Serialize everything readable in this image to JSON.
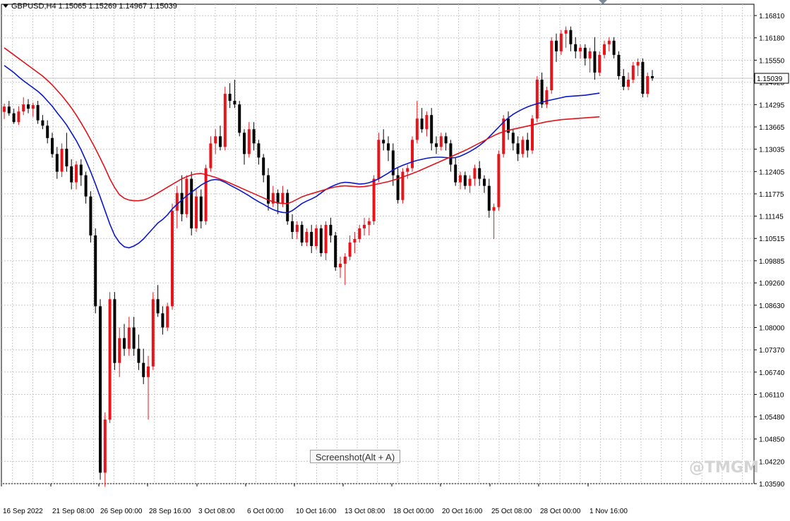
{
  "header": {
    "symbol": "GBPUSD,H4",
    "open": "1.15065",
    "high": "1.15269",
    "low": "1.14967",
    "close": "1.15039"
  },
  "screenshot_button": "Screenshot(Alt + A)",
  "watermark": "@TMGM",
  "colors": {
    "bull": "#e8141c",
    "bear": "#000000",
    "ma_fast": "#0a18c8",
    "ma_slow": "#e0141c",
    "grid": "#c8c8c8",
    "price_line": "#c0c0c0"
  },
  "chart_data": {
    "type": "candlestick",
    "title": "GBPUSD,H4",
    "ylim": [
      1.0359,
      1.1713
    ],
    "y_ticks": [
      "1.16810",
      "1.16180",
      "1.15550",
      "1.14925",
      "1.14295",
      "1.13665",
      "1.13035",
      "1.12405",
      "1.11775",
      "1.11145",
      "1.10515",
      "1.09885",
      "1.09260",
      "1.08630",
      "1.08000",
      "1.07370",
      "1.06740",
      "1.06110",
      "1.05480",
      "1.04850",
      "1.04220",
      "1.03590"
    ],
    "x_ticks": [
      "16 Sep 2022",
      "21 Sep 08:00",
      "26 Sep 00:00",
      "28 Sep 16:00",
      "3 Oct 08:00",
      "6 Oct 00:00",
      "10 Oct 16:00",
      "13 Oct 08:00",
      "18 Oct 00:00",
      "20 Oct 16:00",
      "25 Oct 08:00",
      "28 Oct 00:00",
      "1 Nov 16:00"
    ],
    "current_price": "1.15039",
    "grid": true,
    "candles": [
      [
        1.1409,
        1.1432,
        1.1389,
        1.1424
      ],
      [
        1.1424,
        1.144,
        1.1398,
        1.1405
      ],
      [
        1.1405,
        1.1418,
        1.1375,
        1.138
      ],
      [
        1.138,
        1.1425,
        1.1372,
        1.141
      ],
      [
        1.141,
        1.145,
        1.14,
        1.143
      ],
      [
        1.143,
        1.1445,
        1.1405,
        1.1418
      ],
      [
        1.1418,
        1.1435,
        1.1395,
        1.1428
      ],
      [
        1.1428,
        1.144,
        1.1375,
        1.1385
      ],
      [
        1.1385,
        1.14,
        1.136,
        1.137
      ],
      [
        1.137,
        1.1385,
        1.132,
        1.1335
      ],
      [
        1.1335,
        1.135,
        1.128,
        1.129
      ],
      [
        1.129,
        1.131,
        1.122,
        1.124
      ],
      [
        1.124,
        1.132,
        1.1225,
        1.1305
      ],
      [
        1.1305,
        1.135,
        1.124,
        1.1255
      ],
      [
        1.1255,
        1.1275,
        1.119,
        1.121
      ],
      [
        1.121,
        1.127,
        1.119,
        1.126
      ],
      [
        1.126,
        1.1275,
        1.12,
        1.123
      ],
      [
        1.123,
        1.124,
        1.115,
        1.117
      ],
      [
        1.117,
        1.1185,
        1.104,
        1.106
      ],
      [
        1.106,
        1.108,
        1.084,
        1.086
      ],
      [
        1.086,
        1.088,
        1.037,
        1.039
      ],
      [
        1.039,
        1.056,
        1.035,
        1.054
      ],
      [
        1.054,
        1.09,
        1.053,
        1.088
      ],
      [
        1.088,
        1.09,
        1.068,
        1.07
      ],
      [
        1.07,
        1.08,
        1.066,
        1.077
      ],
      [
        1.077,
        1.081,
        1.072,
        1.074
      ],
      [
        1.074,
        1.083,
        1.072,
        1.08
      ],
      [
        1.08,
        1.083,
        1.072,
        1.074
      ],
      [
        1.074,
        1.078,
        1.068,
        1.07
      ],
      [
        1.07,
        1.074,
        1.064,
        1.066
      ],
      [
        1.066,
        1.072,
        1.054,
        1.069
      ],
      [
        1.069,
        1.09,
        1.068,
        1.088
      ],
      [
        1.088,
        1.092,
        1.083,
        1.084
      ],
      [
        1.084,
        1.086,
        1.078,
        1.08
      ],
      [
        1.08,
        1.087,
        1.079,
        1.086
      ],
      [
        1.086,
        1.115,
        1.085,
        1.113
      ],
      [
        1.113,
        1.12,
        1.108,
        1.118
      ],
      [
        1.118,
        1.123,
        1.11,
        1.112
      ],
      [
        1.112,
        1.123,
        1.111,
        1.122
      ],
      [
        1.122,
        1.124,
        1.106,
        1.108
      ],
      [
        1.108,
        1.119,
        1.107,
        1.117
      ],
      [
        1.117,
        1.119,
        1.108,
        1.11
      ],
      [
        1.11,
        1.126,
        1.109,
        1.125
      ],
      [
        1.125,
        1.134,
        1.124,
        1.132
      ],
      [
        1.132,
        1.136,
        1.129,
        1.134
      ],
      [
        1.134,
        1.137,
        1.13,
        1.131
      ],
      [
        1.131,
        1.148,
        1.13,
        1.146
      ],
      [
        1.146,
        1.149,
        1.142,
        1.144
      ],
      [
        1.144,
        1.15,
        1.142,
        1.143
      ],
      [
        1.143,
        1.144,
        1.134,
        1.135
      ],
      [
        1.135,
        1.136,
        1.126,
        1.129
      ],
      [
        1.129,
        1.138,
        1.128,
        1.136
      ],
      [
        1.136,
        1.138,
        1.13,
        1.132
      ],
      [
        1.132,
        1.133,
        1.126,
        1.128
      ],
      [
        1.128,
        1.129,
        1.121,
        1.123
      ],
      [
        1.123,
        1.125,
        1.113,
        1.115
      ],
      [
        1.115,
        1.12,
        1.114,
        1.118
      ],
      [
        1.118,
        1.119,
        1.112,
        1.115
      ],
      [
        1.115,
        1.12,
        1.114,
        1.118
      ],
      [
        1.118,
        1.119,
        1.109,
        1.11
      ],
      [
        1.11,
        1.112,
        1.105,
        1.107
      ],
      [
        1.107,
        1.11,
        1.105,
        1.109
      ],
      [
        1.109,
        1.11,
        1.103,
        1.104
      ],
      [
        1.104,
        1.108,
        1.103,
        1.107
      ],
      [
        1.107,
        1.109,
        1.101,
        1.103
      ],
      [
        1.103,
        1.109,
        1.102,
        1.108
      ],
      [
        1.108,
        1.109,
        1.1,
        1.101
      ],
      [
        1.101,
        1.11,
        1.099,
        1.109
      ],
      [
        1.109,
        1.111,
        1.104,
        1.106
      ],
      [
        1.106,
        1.107,
        1.096,
        1.097
      ],
      [
        1.097,
        1.1,
        1.094,
        1.098
      ],
      [
        1.098,
        1.101,
        1.092,
        1.1
      ],
      [
        1.1,
        1.106,
        1.099,
        1.104
      ],
      [
        1.104,
        1.107,
        1.101,
        1.105
      ],
      [
        1.105,
        1.109,
        1.104,
        1.108
      ],
      [
        1.108,
        1.111,
        1.106,
        1.109
      ],
      [
        1.109,
        1.111,
        1.106,
        1.11
      ],
      [
        1.11,
        1.123,
        1.109,
        1.122
      ],
      [
        1.122,
        1.135,
        1.121,
        1.133
      ],
      [
        1.133,
        1.136,
        1.13,
        1.132
      ],
      [
        1.132,
        1.134,
        1.127,
        1.13
      ],
      [
        1.13,
        1.132,
        1.12,
        1.123
      ],
      [
        1.123,
        1.125,
        1.115,
        1.116
      ],
      [
        1.116,
        1.125,
        1.115,
        1.124
      ],
      [
        1.124,
        1.126,
        1.122,
        1.125
      ],
      [
        1.125,
        1.134,
        1.124,
        1.133
      ],
      [
        1.133,
        1.144,
        1.132,
        1.139
      ],
      [
        1.139,
        1.142,
        1.135,
        1.136
      ],
      [
        1.136,
        1.141,
        1.134,
        1.14
      ],
      [
        1.14,
        1.142,
        1.13,
        1.132
      ],
      [
        1.132,
        1.134,
        1.129,
        1.131
      ],
      [
        1.131,
        1.135,
        1.13,
        1.134
      ],
      [
        1.134,
        1.135,
        1.13,
        1.132
      ],
      [
        1.132,
        1.133,
        1.124,
        1.126
      ],
      [
        1.126,
        1.128,
        1.12,
        1.121
      ],
      [
        1.121,
        1.124,
        1.119,
        1.123
      ],
      [
        1.123,
        1.124,
        1.119,
        1.12
      ],
      [
        1.12,
        1.123,
        1.118,
        1.122
      ],
      [
        1.122,
        1.126,
        1.12,
        1.125
      ],
      [
        1.125,
        1.127,
        1.12,
        1.122
      ],
      [
        1.122,
        1.123,
        1.118,
        1.12
      ],
      [
        1.12,
        1.122,
        1.111,
        1.113
      ],
      [
        1.113,
        1.115,
        1.105,
        1.114
      ],
      [
        1.114,
        1.13,
        1.113,
        1.129
      ],
      [
        1.129,
        1.14,
        1.128,
        1.139
      ],
      [
        1.139,
        1.141,
        1.133,
        1.135
      ],
      [
        1.135,
        1.136,
        1.13,
        1.132
      ],
      [
        1.132,
        1.134,
        1.127,
        1.129
      ],
      [
        1.129,
        1.134,
        1.128,
        1.133
      ],
      [
        1.133,
        1.135,
        1.128,
        1.13
      ],
      [
        1.13,
        1.14,
        1.129,
        1.139
      ],
      [
        1.139,
        1.151,
        1.138,
        1.15
      ],
      [
        1.15,
        1.152,
        1.142,
        1.143
      ],
      [
        1.143,
        1.148,
        1.142,
        1.147
      ],
      [
        1.147,
        1.162,
        1.146,
        1.161
      ],
      [
        1.161,
        1.163,
        1.155,
        1.158
      ],
      [
        1.158,
        1.164,
        1.157,
        1.163
      ],
      [
        1.163,
        1.165,
        1.159,
        1.164
      ],
      [
        1.164,
        1.165,
        1.158,
        1.16
      ],
      [
        1.16,
        1.162,
        1.156,
        1.158
      ],
      [
        1.158,
        1.16,
        1.156,
        1.159
      ],
      [
        1.159,
        1.16,
        1.154,
        1.156
      ],
      [
        1.156,
        1.159,
        1.152,
        1.158
      ],
      [
        1.158,
        1.162,
        1.15,
        1.152
      ],
      [
        1.152,
        1.158,
        1.151,
        1.157
      ],
      [
        1.157,
        1.161,
        1.156,
        1.16
      ],
      [
        1.16,
        1.162,
        1.158,
        1.161
      ],
      [
        1.161,
        1.162,
        1.156,
        1.157
      ],
      [
        1.157,
        1.158,
        1.15,
        1.151
      ],
      [
        1.151,
        1.153,
        1.147,
        1.148
      ],
      [
        1.148,
        1.152,
        1.147,
        1.15
      ],
      [
        1.15,
        1.155,
        1.149,
        1.154
      ],
      [
        1.154,
        1.156,
        1.151,
        1.155
      ],
      [
        1.155,
        1.156,
        1.145,
        1.146
      ],
      [
        1.146,
        1.152,
        1.145,
        1.151
      ],
      [
        1.151,
        1.1527,
        1.1497,
        1.1504
      ]
    ],
    "series": [
      {
        "name": "",
        "color": "#0a18c8",
        "values": [
          1.154,
          1.153,
          1.152,
          1.1508,
          1.1497,
          1.1487,
          1.1477,
          1.1467,
          1.1455,
          1.144,
          1.1425,
          1.1407,
          1.139,
          1.1372,
          1.135,
          1.1328,
          1.1302,
          1.1272,
          1.124,
          1.1205,
          1.1168,
          1.113,
          1.1092,
          1.106,
          1.104,
          1.1028,
          1.1025,
          1.103,
          1.1038,
          1.105,
          1.1065,
          1.108,
          1.1095,
          1.1105,
          1.1118,
          1.1135,
          1.1148,
          1.116,
          1.1172,
          1.1182,
          1.1192,
          1.1202,
          1.121,
          1.1216,
          1.1218,
          1.1216,
          1.121,
          1.1202,
          1.1195,
          1.1188,
          1.118,
          1.1172,
          1.1163,
          1.1155,
          1.1148,
          1.114,
          1.1133,
          1.1128,
          1.1125,
          1.1124,
          1.113,
          1.114,
          1.115,
          1.1157,
          1.1163,
          1.117,
          1.118,
          1.119,
          1.1197,
          1.1203,
          1.1208,
          1.121,
          1.1209,
          1.1207,
          1.1205,
          1.1206,
          1.1209,
          1.1214,
          1.122,
          1.1228,
          1.1236,
          1.1245,
          1.1252,
          1.1258,
          1.1263,
          1.1268,
          1.1272,
          1.1275,
          1.1278,
          1.128,
          1.1281,
          1.1281,
          1.128,
          1.1279,
          1.128,
          1.1284,
          1.129,
          1.1297,
          1.1305,
          1.1314,
          1.1325,
          1.1338,
          1.1352,
          1.1366,
          1.138,
          1.1392,
          1.1402,
          1.141,
          1.1417,
          1.1423,
          1.1428,
          1.1432,
          1.1436,
          1.144,
          1.1443,
          1.1446,
          1.1449,
          1.1452,
          1.1453,
          1.1454,
          1.1455,
          1.1456,
          1.1458,
          1.146,
          1.1462
        ]
      },
      {
        "name": "",
        "color": "#e0141c",
        "values": [
          1.159,
          1.158,
          1.157,
          1.156,
          1.155,
          1.154,
          1.153,
          1.152,
          1.151,
          1.1498,
          1.1485,
          1.147,
          1.1455,
          1.1438,
          1.142,
          1.14,
          1.1378,
          1.1355,
          1.133,
          1.1305,
          1.1278,
          1.125,
          1.122,
          1.1195,
          1.1175,
          1.1165,
          1.116,
          1.1158,
          1.1158,
          1.116,
          1.1165,
          1.1172,
          1.118,
          1.1188,
          1.1196,
          1.1204,
          1.1212,
          1.122,
          1.1226,
          1.1231,
          1.1234,
          1.1235,
          1.1232,
          1.1228,
          1.1224,
          1.1219,
          1.1214,
          1.1208,
          1.1202,
          1.1196,
          1.119,
          1.1184,
          1.1178,
          1.1172,
          1.1166,
          1.116,
          1.1155,
          1.1152,
          1.115,
          1.115,
          1.1155,
          1.1162,
          1.1169,
          1.1174,
          1.1178,
          1.1182,
          1.1186,
          1.119,
          1.1194,
          1.1197,
          1.1199,
          1.12,
          1.1199,
          1.1198,
          1.1197,
          1.1198,
          1.12,
          1.1203,
          1.1206,
          1.1209,
          1.1212,
          1.1216,
          1.122,
          1.1225,
          1.123,
          1.1235,
          1.124,
          1.1246,
          1.1252,
          1.1258,
          1.1264,
          1.127,
          1.1276,
          1.1282,
          1.1288,
          1.1294,
          1.13,
          1.1307,
          1.1314,
          1.1321,
          1.1328,
          1.1335,
          1.1342,
          1.1348,
          1.1353,
          1.1357,
          1.136,
          1.1363,
          1.1366,
          1.1369,
          1.1372,
          1.1375,
          1.1378,
          1.1381,
          1.1383,
          1.1385,
          1.1387,
          1.1388,
          1.1389,
          1.139,
          1.1391,
          1.1392,
          1.1393,
          1.1394,
          1.1395
        ]
      }
    ]
  }
}
